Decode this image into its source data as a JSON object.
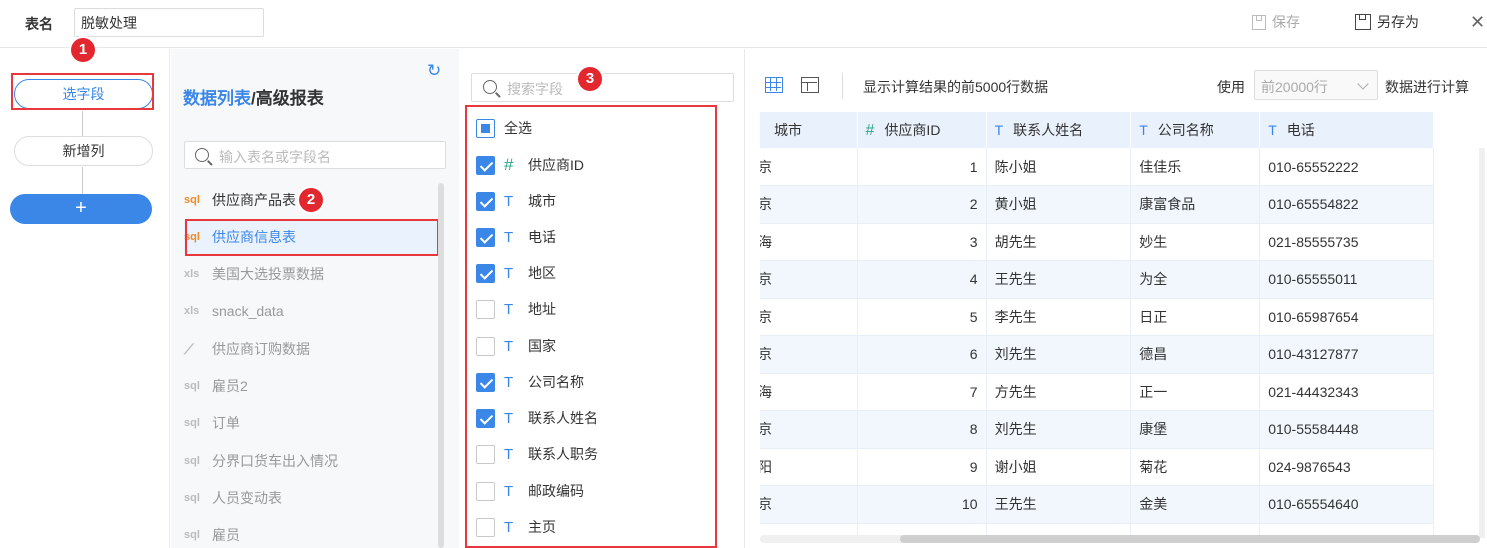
{
  "topbar": {
    "table_name_label": "表名",
    "table_name_value": "脱敏处理",
    "save_label": "保存",
    "save_as_label": "另存为"
  },
  "steps": {
    "select_fields": "选字段",
    "new_column": "新增列",
    "add": "+"
  },
  "badges": [
    "1",
    "2",
    "3"
  ],
  "list_panel": {
    "title_part1": "数据列表",
    "title_sep": "/",
    "title_part2": "高级报表",
    "search_placeholder": "输入表名或字段名",
    "items": [
      {
        "icon": "sql",
        "label": "供应商产品表"
      },
      {
        "icon": "sql",
        "label": "供应商信息表"
      },
      {
        "icon": "xls",
        "label": "美国大选投票数据"
      },
      {
        "icon": "xls",
        "label": "snack_data"
      },
      {
        "icon": "trend",
        "label": "供应商订购数据"
      },
      {
        "icon": "sql",
        "label": "雇员2"
      },
      {
        "icon": "sql",
        "label": "订单"
      },
      {
        "icon": "sql",
        "label": "分界口货车出入情况"
      },
      {
        "icon": "sql",
        "label": "人员变动表"
      },
      {
        "icon": "sql",
        "label": "雇员"
      }
    ]
  },
  "field_panel": {
    "search_placeholder": "搜索字段",
    "select_all": "全选",
    "fields": [
      {
        "type": "#",
        "label": "供应商ID",
        "checked": true
      },
      {
        "type": "T",
        "label": "城市",
        "checked": true
      },
      {
        "type": "T",
        "label": "电话",
        "checked": true
      },
      {
        "type": "T",
        "label": "地区",
        "checked": true
      },
      {
        "type": "T",
        "label": "地址",
        "checked": false
      },
      {
        "type": "T",
        "label": "国家",
        "checked": false
      },
      {
        "type": "T",
        "label": "公司名称",
        "checked": true
      },
      {
        "type": "T",
        "label": "联系人姓名",
        "checked": true
      },
      {
        "type": "T",
        "label": "联系人职务",
        "checked": false
      },
      {
        "type": "T",
        "label": "邮政编码",
        "checked": false
      },
      {
        "type": "T",
        "label": "主页",
        "checked": false
      }
    ]
  },
  "preview": {
    "info": "显示计算结果的前5000行数据",
    "use_label": "使用",
    "row_limit": "前20000行",
    "compute_label": "数据进行计算",
    "columns": [
      {
        "type": "",
        "label": "城市"
      },
      {
        "type": "#",
        "label": "供应商ID"
      },
      {
        "type": "T",
        "label": "联系人姓名"
      },
      {
        "type": "T",
        "label": "公司名称"
      },
      {
        "type": "T",
        "label": "电话"
      }
    ],
    "rows": [
      [
        "京",
        "1",
        "陈小姐",
        "佳佳乐",
        "010-65552222"
      ],
      [
        "京",
        "2",
        "黄小姐",
        "康富食品",
        "010-65554822"
      ],
      [
        "海",
        "3",
        "胡先生",
        "妙生",
        "021-85555735"
      ],
      [
        "京",
        "4",
        "王先生",
        "为全",
        "010-65555011"
      ],
      [
        "京",
        "5",
        "李先生",
        "日正",
        "010-65987654"
      ],
      [
        "京",
        "6",
        "刘先生",
        "德昌",
        "010-43127877"
      ],
      [
        "海",
        "7",
        "方先生",
        "正一",
        "021-44432343"
      ],
      [
        "京",
        "8",
        "刘先生",
        "康堡",
        "010-55584448"
      ],
      [
        "阳",
        "9",
        "谢小姐",
        "菊花",
        "024-9876543"
      ],
      [
        "京",
        "10",
        "王先生",
        "金美",
        "010-65554640"
      ],
      [
        "",
        "",
        "",
        "",
        ""
      ]
    ]
  },
  "colors": {
    "accent": "#3a87e8",
    "annotation": "#e8383d",
    "number_type": "#2ea58a",
    "sql_icon": "#f08a25"
  }
}
